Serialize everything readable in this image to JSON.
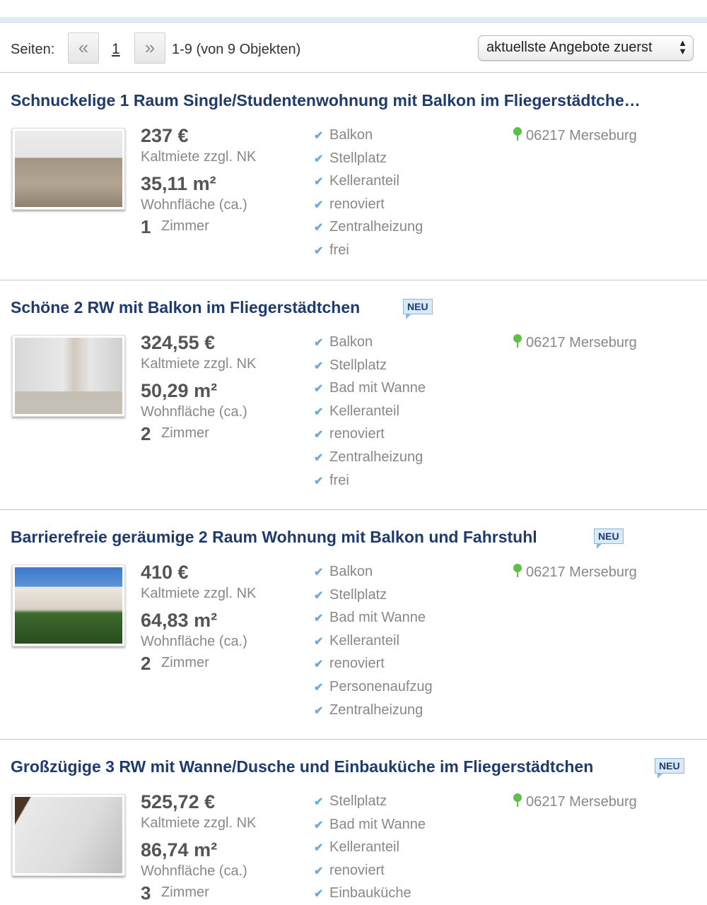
{
  "pager": {
    "label": "Seiten:",
    "prev": "«",
    "page": "1",
    "next": "»",
    "range": "1-9 (von 9 Objekten)",
    "sort": "aktuellste Angebote zuerst"
  },
  "listings": [
    {
      "title": "Schnuckelige 1 Raum Single/Studentenwohnung mit Balkon im Fliegerstädtche…",
      "badge": "",
      "price": "237 €",
      "price_label": "Kaltmiete zzgl. NK",
      "area": "35,11 m²",
      "area_label": "Wohnfläche (ca.)",
      "rooms": "1",
      "rooms_label": "Zimmer",
      "features": [
        "Balkon",
        "Stellplatz",
        "Kelleranteil",
        "renoviert",
        "Zentralheizung",
        "frei"
      ],
      "location": "06217 Merseburg"
    },
    {
      "title": "Schöne 2 RW mit Balkon im Fliegerstädtchen",
      "badge": "NEU",
      "price": "324,55 €",
      "price_label": "Kaltmiete zzgl. NK",
      "area": "50,29 m²",
      "area_label": "Wohnfläche (ca.)",
      "rooms": "2",
      "rooms_label": "Zimmer",
      "features": [
        "Balkon",
        "Stellplatz",
        "Bad mit Wanne",
        "Kelleranteil",
        "renoviert",
        "Zentralheizung",
        "frei"
      ],
      "location": "06217 Merseburg"
    },
    {
      "title": "Barrierefreie geräumige 2 Raum Wohnung mit Balkon und Fahrstuhl",
      "badge": "NEU",
      "price": "410 €",
      "price_label": "Kaltmiete zzgl. NK",
      "area": "64,83 m²",
      "area_label": "Wohnfläche (ca.)",
      "rooms": "2",
      "rooms_label": "Zimmer",
      "features": [
        "Balkon",
        "Stellplatz",
        "Bad mit Wanne",
        "Kelleranteil",
        "renoviert",
        "Personenaufzug",
        "Zentralheizung"
      ],
      "location": "06217 Merseburg"
    },
    {
      "title": "Großzügige 3 RW mit Wanne/Dusche und Einbauküche im Fliegerstädtchen",
      "badge": "NEU",
      "price": "525,72 €",
      "price_label": "Kaltmiete zzgl. NK",
      "area": "86,74 m²",
      "area_label": "Wohnfläche (ca.)",
      "rooms": "3",
      "rooms_label": "Zimmer",
      "features": [
        "Stellplatz",
        "Bad mit Wanne",
        "Kelleranteil",
        "renoviert",
        "Einbauküche"
      ],
      "location": "06217 Merseburg"
    }
  ]
}
